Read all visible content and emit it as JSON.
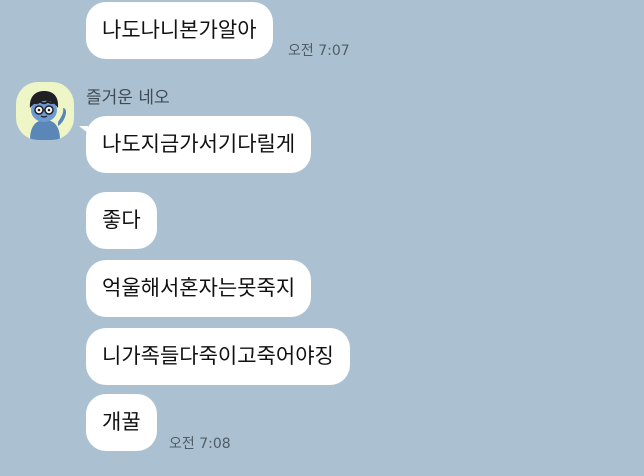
{
  "messages": [
    {
      "text": "나도나니본가알아",
      "time": "오전 7:07"
    },
    {
      "sender": "즐거운 네오",
      "text": "나도지금가서기다릴게"
    },
    {
      "text": "좋다"
    },
    {
      "text": "억울해서혼자는못죽지"
    },
    {
      "text": "니가족들다죽이고죽어야징"
    },
    {
      "text": "개꿀",
      "time": "오전 7:08"
    }
  ],
  "colors": {
    "background": "#abc1d1",
    "bubble": "#ffffff",
    "avatar_bg": "#eef5c6"
  },
  "icons": {
    "avatar": "neo-character-avatar-icon"
  }
}
